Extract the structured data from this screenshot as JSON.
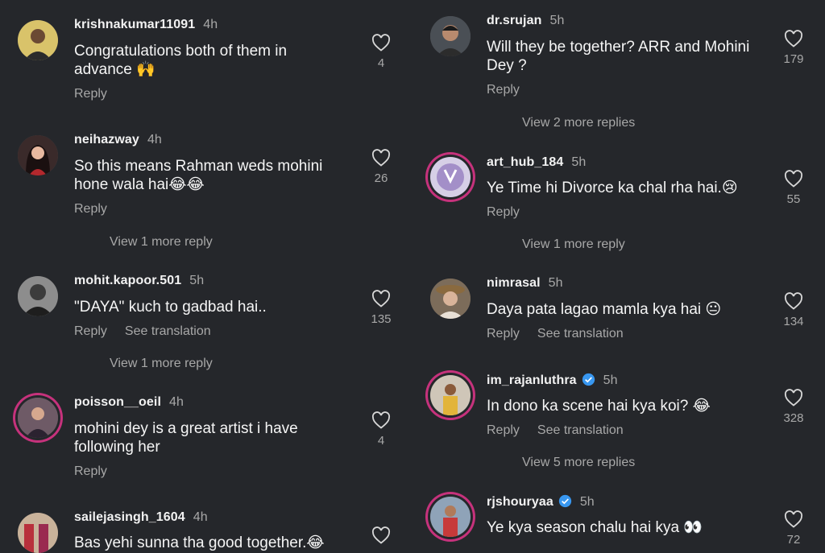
{
  "left": {
    "c1": {
      "user": "krishnakumar11091",
      "time": "4h",
      "text_line1": "Congratulations both of them in",
      "text_line2": "advance 🙌",
      "reply": "Reply",
      "likes": "4"
    },
    "c2": {
      "user": "neihazway",
      "time": "4h",
      "text_line1": "So this means Rahman weds mohini",
      "text_line2": "hone wala hai😂😂",
      "reply": "Reply",
      "likes": "26",
      "more": "View 1 more reply"
    },
    "c3": {
      "user": "mohit.kapoor.501",
      "time": "5h",
      "text_line1": "\"DAYA\" kuch to gadbad hai..",
      "reply": "Reply",
      "translate": "See translation",
      "likes": "135",
      "more": "View 1 more reply"
    },
    "c4": {
      "user": "poisson__oeil",
      "time": "4h",
      "text_line1": "mohini dey is a great artist i have",
      "text_line2": "following her",
      "reply": "Reply",
      "likes": "4"
    },
    "c5": {
      "user": "sailejasingh_1604",
      "time": "4h",
      "text_line1": "Bas yehi sunna tha good together.😂"
    }
  },
  "right": {
    "c1": {
      "user": "dr.srujan",
      "time": "5h",
      "text_line1": "Will they be together? ARR and Mohini",
      "text_line2": "Dey ?",
      "reply": "Reply",
      "likes": "179",
      "more": "View 2 more replies"
    },
    "c2": {
      "user": "art_hub_184",
      "time": "5h",
      "text_line1": "Ye Time hi Divorce ka chal rha hai.😢",
      "reply": "Reply",
      "likes": "55",
      "more": "View 1 more reply"
    },
    "c3": {
      "user": "nimrasal",
      "time": "5h",
      "text_line1": "Daya pata lagao mamla kya hai 😐",
      "reply": "Reply",
      "translate": "See translation",
      "likes": "134"
    },
    "c4": {
      "user": "im_rajanluthra",
      "time": "5h",
      "text_line1": "In dono ka scene hai kya koi? 😂",
      "reply": "Reply",
      "translate": "See translation",
      "likes": "328",
      "more": "View 5 more replies"
    },
    "c5": {
      "user": "rjshouryaa",
      "time": "5h",
      "text_line1": "Ye kya season chalu hai kya 👀",
      "likes": "72"
    }
  },
  "colors": {
    "background": "#25272b",
    "muted": "#a8a8a8",
    "story_ring": "#c6327c",
    "verified": "#3897f0"
  },
  "icons": {
    "like": "heart-outline-icon",
    "verified": "verified-badge-icon"
  }
}
